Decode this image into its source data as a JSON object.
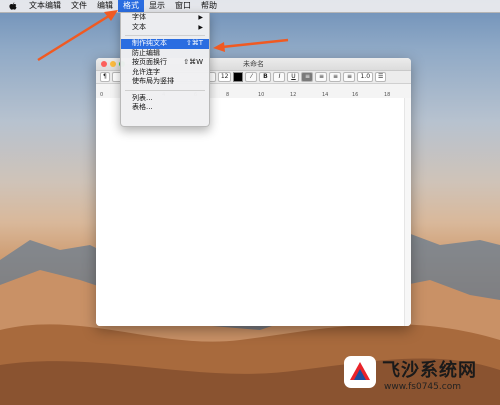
{
  "menubar": {
    "items": [
      {
        "label": "文本编辑"
      },
      {
        "label": "文件"
      },
      {
        "label": "编辑"
      },
      {
        "label": "格式"
      },
      {
        "label": "显示"
      },
      {
        "label": "窗口"
      },
      {
        "label": "帮助"
      }
    ]
  },
  "window": {
    "title": "未命名",
    "toolbar": {
      "paragraph_style": "¶",
      "font_size": "12",
      "bold": "B",
      "italic": "I",
      "underline": "U",
      "line_spacing": "1.0"
    },
    "ruler_ticks": [
      "0",
      "2",
      "4",
      "6",
      "8",
      "10",
      "12",
      "14",
      "16",
      "18"
    ]
  },
  "format_menu": {
    "items": [
      {
        "label": "字体",
        "submenu": true
      },
      {
        "label": "文本",
        "submenu": true
      },
      {
        "label": "制作纯文本",
        "shortcut": "⇧⌘T",
        "highlighted": true
      },
      {
        "label": "防止编辑"
      },
      {
        "label": "按页面换行",
        "shortcut": "⇧⌘W"
      },
      {
        "label": "允许连字"
      },
      {
        "label": "使布局为竖排"
      },
      {
        "label": "列表..."
      },
      {
        "label": "表格..."
      }
    ]
  },
  "watermark": {
    "title": "飞沙系统网",
    "url": "www.fs0745.com"
  },
  "colors": {
    "accent": "#2a6de1",
    "annotation_arrow": "#f05a22"
  }
}
